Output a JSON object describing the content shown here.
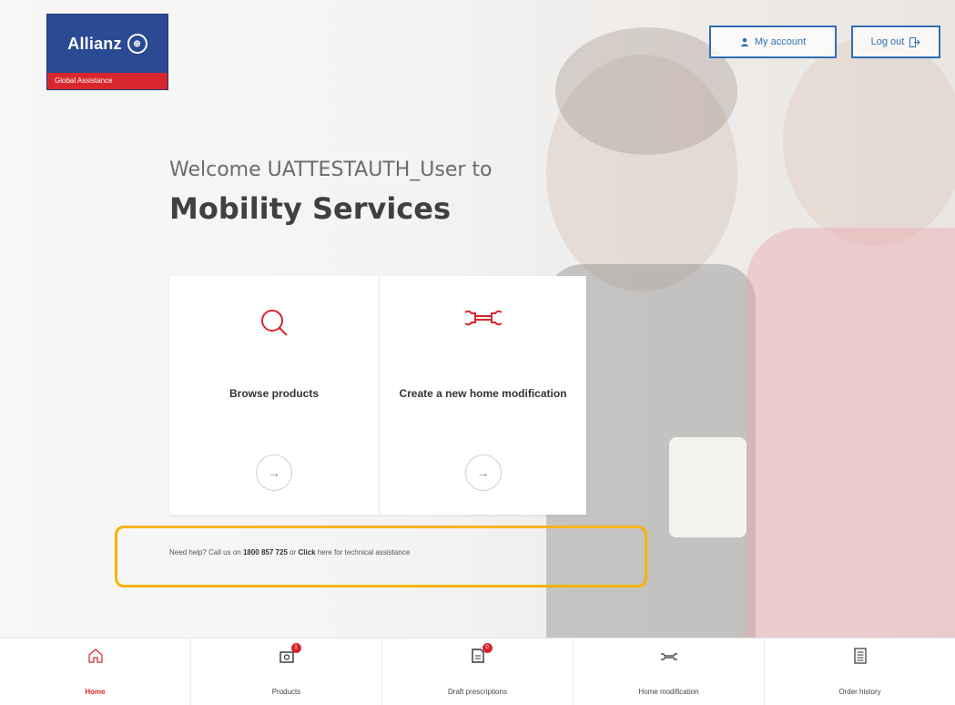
{
  "header": {
    "logo_brand": "Allianz",
    "logo_subtitle": "Global Assistance",
    "my_account_label": "My account",
    "logout_label": "Log out"
  },
  "main": {
    "welcome_text": "Welcome UATTESTAUTH_User to",
    "title": "Mobility Services",
    "cards": [
      {
        "label": "Browse products",
        "icon": "search-icon"
      },
      {
        "label": "Create a new home modification",
        "icon": "wrench-icon"
      }
    ],
    "help": {
      "prefix": "Need help? Call us on",
      "phone": "1800 857 725",
      "middle": "or",
      "link": "Click",
      "suffix": "here for technical assistance"
    }
  },
  "footer": {
    "tabs": [
      {
        "label": "Home",
        "icon": "home-icon",
        "active": true
      },
      {
        "label": "Products",
        "icon": "box-icon",
        "badge": "1"
      },
      {
        "label": "Draft prescriptions",
        "icon": "document-icon",
        "badge": "0"
      },
      {
        "label": "Home modification",
        "icon": "wrench-icon"
      },
      {
        "label": "Order history",
        "icon": "list-icon"
      }
    ]
  },
  "colors": {
    "brand_blue": "#2a4a94",
    "brand_red": "#d8262d",
    "button_blue": "#2e6fb3",
    "highlight": "#f5b400"
  }
}
